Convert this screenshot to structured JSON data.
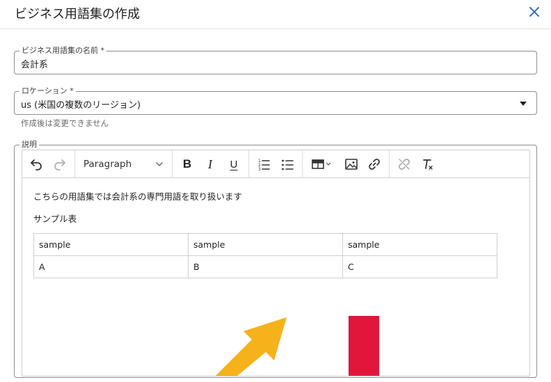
{
  "dialog": {
    "title": "ビジネス用語集の作成",
    "close_icon": "close-icon"
  },
  "form": {
    "name": {
      "label": "ビジネス用語集の名前 *",
      "value": "会計系"
    },
    "location": {
      "label": "ロケーション *",
      "value": "us (米国の複数のリージョン)",
      "helper": "作成後は変更できません"
    },
    "description": {
      "label": "説明"
    }
  },
  "toolbar": {
    "undo_icon": "undo-icon",
    "redo_icon": "redo-icon",
    "paragraph_label": "Paragraph",
    "bold_label": "B",
    "italic_label": "I",
    "underline_label": "U",
    "numbered_list_icon": "numbered-list-icon",
    "bulleted_list_icon": "bulleted-list-icon",
    "table_icon": "table-icon",
    "image_icon": "image-icon",
    "link_icon": "link-icon",
    "unlink_icon": "unlink-icon",
    "clear_format_icon": "clear-format-icon"
  },
  "editor": {
    "line1": "こちらの用語集では会計系の専門用語を取り扱います",
    "line2": "サンプル表",
    "table": {
      "rows": [
        [
          "sample",
          "sample",
          "sample"
        ],
        [
          "A",
          "B",
          "C"
        ]
      ]
    },
    "illustration": {
      "arrow_color": "#f5b21a",
      "bar_color": "#e2163a"
    }
  }
}
